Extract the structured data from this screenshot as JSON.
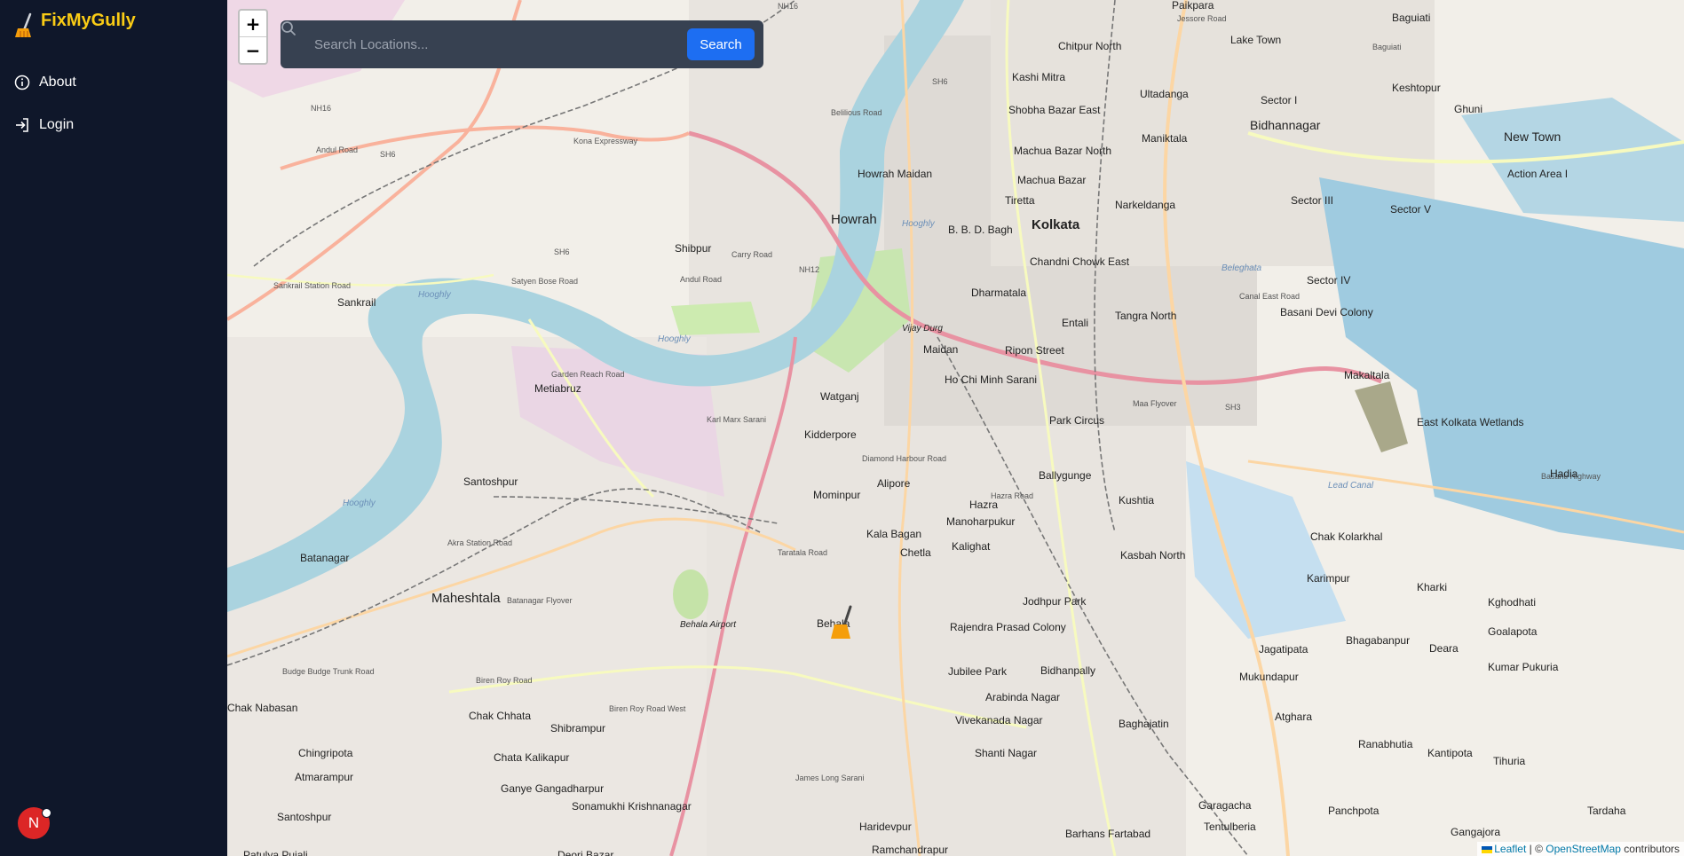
{
  "app": {
    "name": "FixMyGully"
  },
  "nav": {
    "items": [
      {
        "label": "About",
        "icon": "info-icon"
      },
      {
        "label": "Login",
        "icon": "login-icon"
      }
    ]
  },
  "user": {
    "initial": "N"
  },
  "search": {
    "placeholder": "Search Locations...",
    "button_label": "Search"
  },
  "zoom": {
    "in_label": "+",
    "out_label": "−"
  },
  "attribution": {
    "leaflet": "Leaflet",
    "separator": " | © ",
    "osm": "OpenStreetMap",
    "suffix": " contributors"
  },
  "colors": {
    "sidebar": "#0f172a",
    "brand": "#facc15",
    "search_button": "#1d6ef2",
    "water": "#aad3df",
    "motorway": "#e892a2",
    "marker": "#f59e0b"
  },
  "map": {
    "places": [
      "Paikpara",
      "Baguiati",
      "Lake Town",
      "Chitpur North",
      "Kashi Mitra",
      "Ultadanga",
      "Shobha Bazar East",
      "Machua Bazar North",
      "Machua Bazar",
      "Maniktala",
      "Howrah Maidan",
      "Howrah",
      "Tiretta",
      "Kolkata",
      "B. B. D. Bagh",
      "Narkeldanga",
      "Chandni Chowk East",
      "Sector I",
      "Bidhannagar",
      "Ghuni",
      "New Town",
      "Keshtopur",
      "Action Area I",
      "Sector III",
      "Sector V",
      "Sector IV",
      "Shibpur",
      "Sankrail",
      "Dharmatala",
      "Entali",
      "Tangra North",
      "Basani Devi Colony",
      "Maidan",
      "Ripon Street",
      "Metiabruz",
      "Ho Chi Minh Sarani",
      "Watganj",
      "Makaltala",
      "Park Circus",
      "Kidderpore",
      "East Kolkata Wetlands",
      "Santoshpur",
      "Ballygunge",
      "Mominpur",
      "Alipore",
      "Hazra",
      "Kushtia",
      "Hadia",
      "Manoharpukur",
      "Kala Bagan",
      "Chetla",
      "Kalighat",
      "Chak Kolarkhal",
      "Kasbah North",
      "Batanagar",
      "Maheshtala",
      "Karimpur",
      "Kharki",
      "Kghodhati",
      "Jodhpur Park",
      "Behala",
      "Rajendra Prasad Colony",
      "Goalapota",
      "Deara",
      "Bhagabanpur",
      "Jagatipata",
      "Jubilee Park",
      "Bidhanpally",
      "Mukundapur",
      "Kumar Pukuria",
      "Chak Nabasan",
      "Arabinda Nagar",
      "Chak Chhata",
      "Shibrampur",
      "Baghajatin",
      "Atghara",
      "Vivekanada Nagar",
      "Ranabhutia",
      "Chingripota",
      "Chata Kalikapur",
      "Kantipota",
      "Shanti Nagar",
      "Tihuria",
      "Atmarampur",
      "Ganye Gangadharpur",
      "Santoshpur",
      "Sonamukhi Krishnanagar",
      "Garagacha",
      "Panchpota",
      "Tardaha",
      "Tentulberia",
      "Haridevpur",
      "Barhans Fartabad",
      "Gangajora",
      "Ramchandrapur",
      "Deori Bazar",
      "Patulya Pujali",
      "Vijay Durg",
      "Behala Airport"
    ],
    "road_labels": [
      "NH16",
      "NH16",
      "SH6",
      "SH6",
      "SH6",
      "NH12",
      "SH3",
      "Andul Road",
      "Andul Road",
      "Kona Expressway",
      "Sankrail Station Road",
      "Satyen Bose Road",
      "Garden Reach Road",
      "Budge Budge Trunk Road",
      "Taratala Road",
      "Hazra Road",
      "Basanti Highway",
      "Canal East Road",
      "Jessore Road",
      "Maa Flyover",
      "Belilious Road",
      "Biren Roy Road",
      "Biren Roy Road West",
      "Diamond Harbour Road",
      "James Long Sarani",
      "Karl Marx Sarani",
      "Batanagar Flyover",
      "Akra Station Road",
      "Carry Road",
      "Baguiati"
    ],
    "water_labels": [
      "Hooghly",
      "Hooghly",
      "Hooghly",
      "Hooghly",
      "Lead Canal",
      "Beleghata"
    ]
  }
}
